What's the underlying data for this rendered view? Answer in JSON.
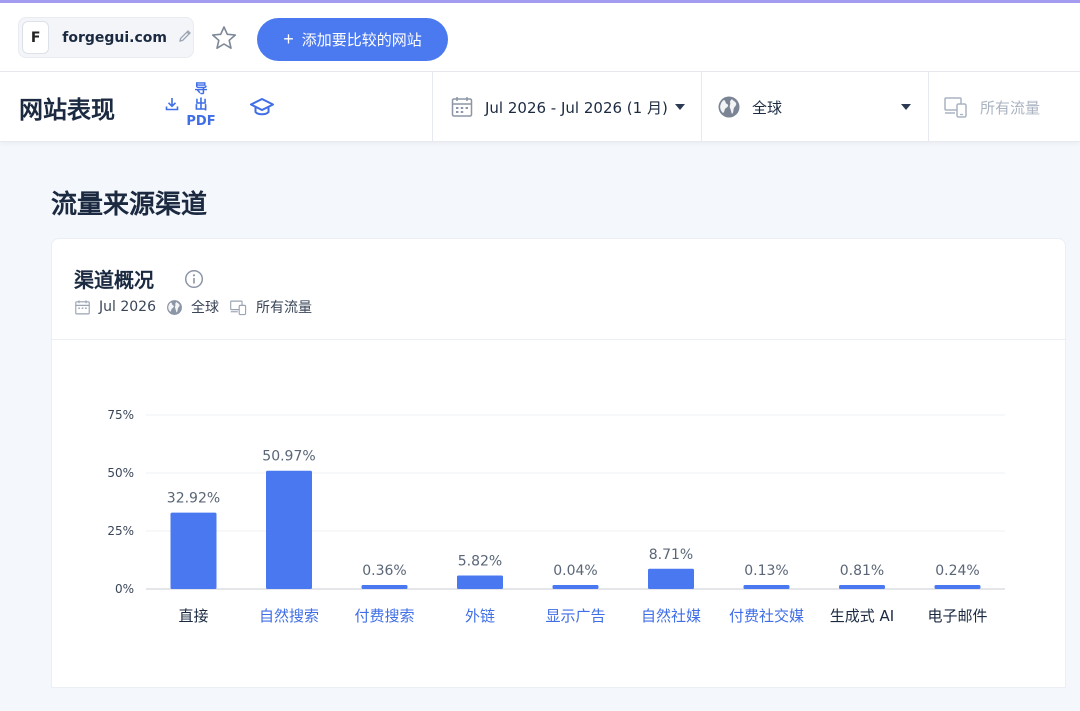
{
  "topbar": {
    "site_logo": "F",
    "site_name": "forgegui.com",
    "compare_label": "添加要比较的网站"
  },
  "subbar": {
    "title": "网站表现",
    "export_label_line1": "导",
    "export_label_line2": "出",
    "export_label_line3": "PDF",
    "date_range": "Jul 2026 - Jul 2026 (1 月)",
    "geo": "全球",
    "traffic": "所有流量"
  },
  "section": {
    "title": "流量来源渠道"
  },
  "card": {
    "title": "渠道概况",
    "meta_date": "Jul 2026",
    "meta_geo": "全球",
    "meta_traffic": "所有流量"
  },
  "colors": {
    "accent": "#4b79f0",
    "link": "#3f6ee7",
    "bar": "#4a78f0"
  },
  "chart_data": {
    "type": "bar",
    "categories": [
      "直接",
      "自然搜索",
      "付费搜索",
      "外链",
      "显示广告",
      "自然社媒",
      "付费社交媒",
      "生成式 AI",
      "电子邮件"
    ],
    "category_links": [
      false,
      true,
      true,
      true,
      true,
      true,
      true,
      false,
      false
    ],
    "values": [
      32.92,
      50.97,
      0.36,
      5.82,
      0.04,
      8.71,
      0.13,
      0.81,
      0.24
    ],
    "value_labels": [
      "32.92%",
      "50.97%",
      "0.36%",
      "5.82%",
      "0.04%",
      "8.71%",
      "0.13%",
      "0.81%",
      "0.24%"
    ],
    "yticks": [
      0,
      25,
      50,
      75
    ],
    "ytick_labels": [
      "0%",
      "25%",
      "50%",
      "75%"
    ],
    "ylim": [
      0,
      75
    ],
    "grid": true
  }
}
